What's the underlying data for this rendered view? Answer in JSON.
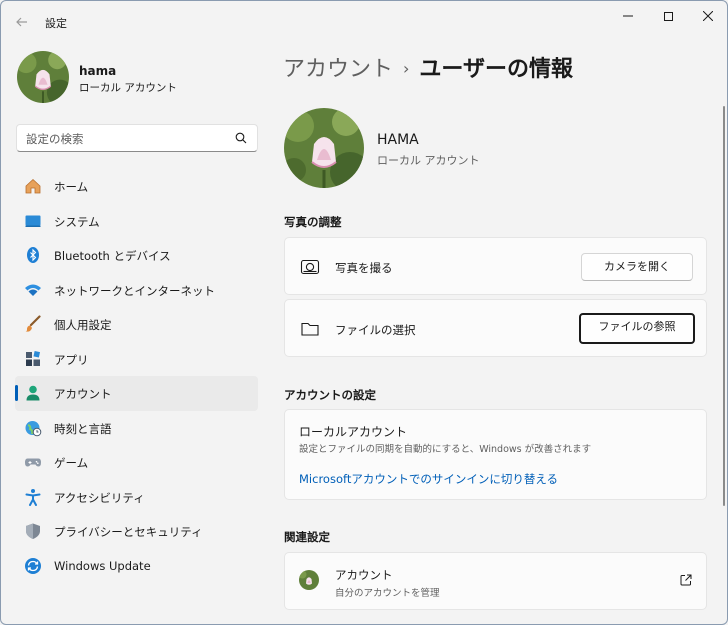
{
  "window": {
    "title": "設定"
  },
  "profile": {
    "name": "hama",
    "type": "ローカル アカウント"
  },
  "search": {
    "placeholder": "設定の検索"
  },
  "nav": {
    "items": [
      {
        "label": "ホーム",
        "icon": "home-icon"
      },
      {
        "label": "システム",
        "icon": "system-icon"
      },
      {
        "label": "Bluetooth とデバイス",
        "icon": "bluetooth-icon"
      },
      {
        "label": "ネットワークとインターネット",
        "icon": "wifi-icon"
      },
      {
        "label": "個人用設定",
        "icon": "brush-icon"
      },
      {
        "label": "アプリ",
        "icon": "apps-icon"
      },
      {
        "label": "アカウント",
        "icon": "account-icon",
        "selected": true
      },
      {
        "label": "時刻と言語",
        "icon": "globe-clock-icon"
      },
      {
        "label": "ゲーム",
        "icon": "gamepad-icon"
      },
      {
        "label": "アクセシビリティ",
        "icon": "accessibility-icon"
      },
      {
        "label": "プライバシーとセキュリティ",
        "icon": "shield-icon"
      },
      {
        "label": "Windows Update",
        "icon": "update-icon"
      }
    ]
  },
  "breadcrumb": {
    "parent": "アカウント",
    "separator": "›",
    "current": "ユーザーの情報"
  },
  "user": {
    "name": "HAMA",
    "type": "ローカル アカウント"
  },
  "photo": {
    "section_title": "写真の調整",
    "take_photo": {
      "label": "写真を撮る",
      "button": "カメラを開く"
    },
    "choose_file": {
      "label": "ファイルの選択",
      "button": "ファイルの参照"
    }
  },
  "account_settings": {
    "section_title": "アカウントの設定",
    "local_title": "ローカルアカウント",
    "local_desc": "設定とファイルの同期を自動的にすると、Windows が改善されます",
    "switch_link": "Microsoftアカウントでのサインインに切り替える"
  },
  "related": {
    "section_title": "関連設定",
    "item_title": "アカウント",
    "item_sub": "自分のアカウントを管理"
  },
  "colors": {
    "accent": "#005fb8",
    "background": "#f3f3f3",
    "card": "#fbfbfb"
  }
}
